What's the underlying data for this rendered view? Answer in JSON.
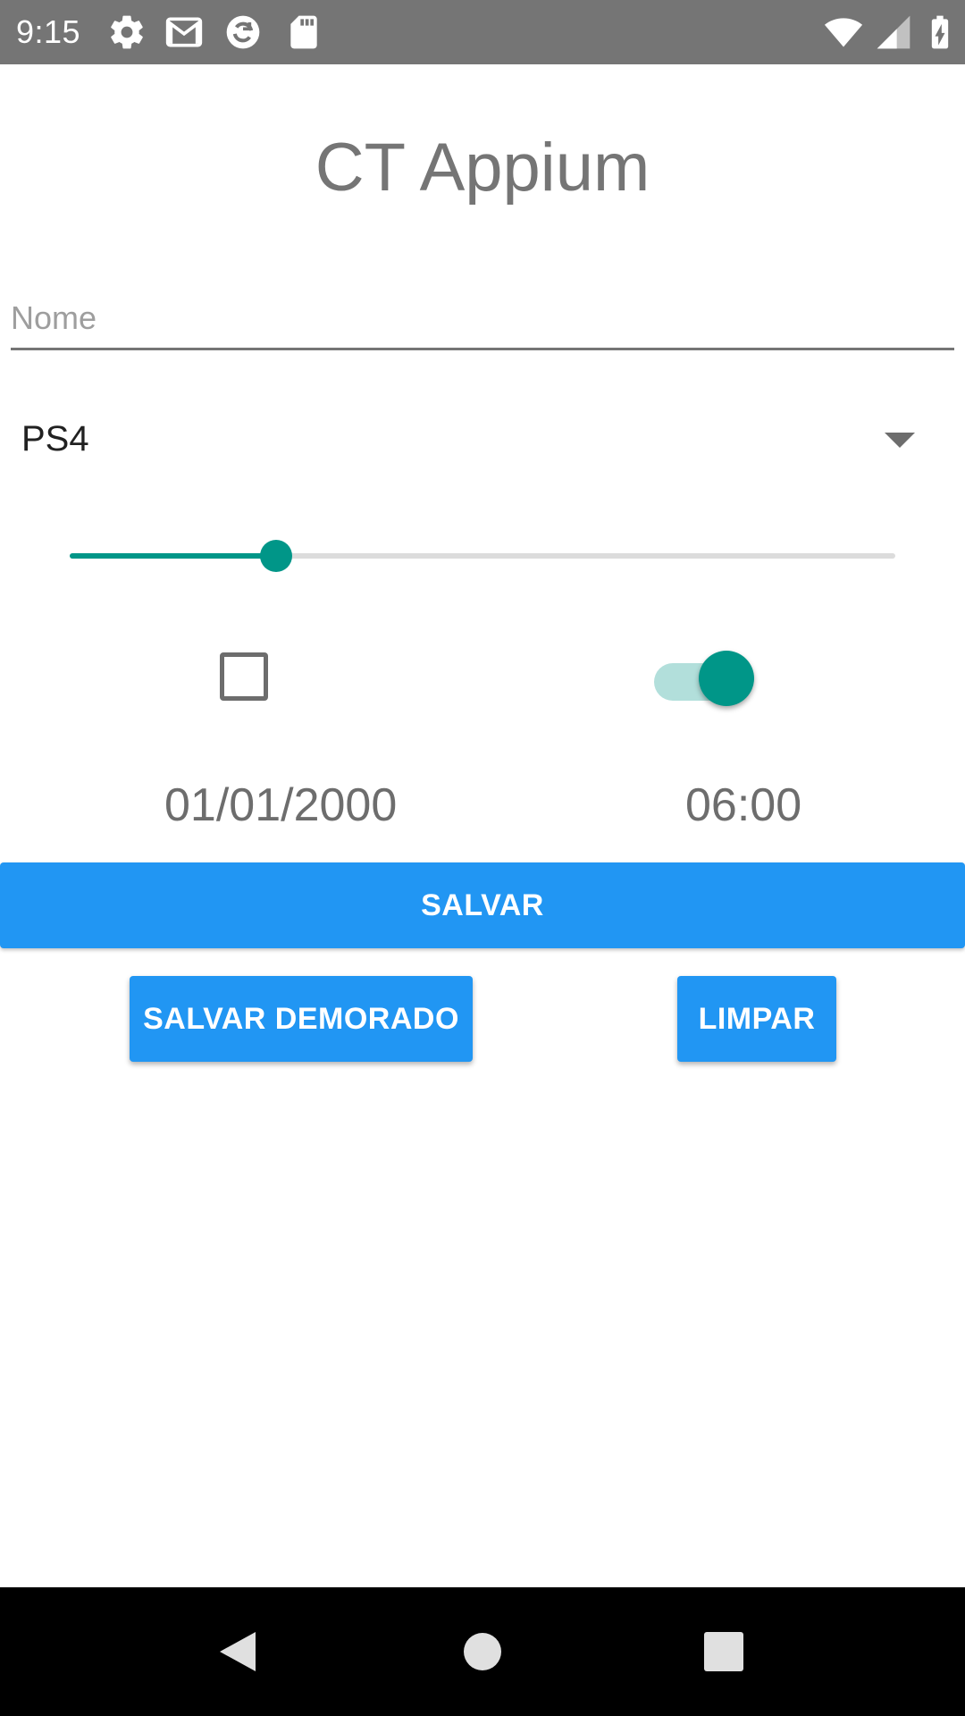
{
  "status_bar": {
    "time": "9:15",
    "left_icons": [
      "settings-icon",
      "gmail-icon",
      "sync-icon",
      "sd-card-icon"
    ],
    "right_icons": [
      "wifi-icon",
      "signal-icon",
      "battery-charging-icon"
    ]
  },
  "app": {
    "title": "CT Appium"
  },
  "form": {
    "name_placeholder": "Nome",
    "name_value": "",
    "console_selected": "PS4",
    "seekbar_progress_percent": 25,
    "checkbox_checked": false,
    "switch_on": true,
    "date": "01/01/2000",
    "time": "06:00"
  },
  "buttons": {
    "save": "SALVAR",
    "save_slow": "SALVAR DEMORADO",
    "clear": "LIMPAR"
  },
  "colors": {
    "accent": "#009688",
    "accent_light": "#b2dfdb",
    "button": "#2196f3",
    "status_bar": "#757575",
    "nav_bar": "#000000"
  },
  "nav_bar": {
    "buttons": [
      "back-icon",
      "home-icon",
      "recents-icon"
    ]
  }
}
